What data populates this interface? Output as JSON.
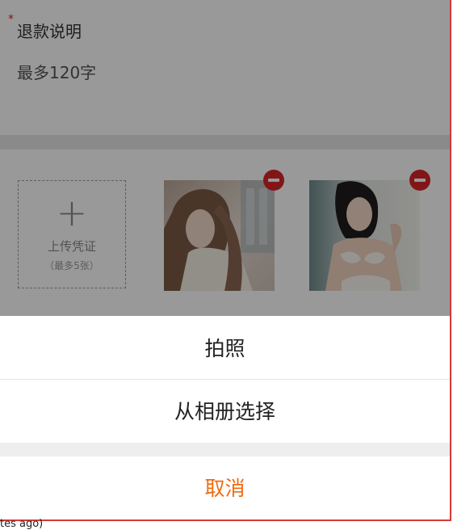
{
  "refund": {
    "required_mark": "*",
    "title": "退款说明",
    "placeholder": "最多120字"
  },
  "upload": {
    "plus_glyph": "+",
    "label": "上传凭证",
    "hint": "（最多5张）"
  },
  "thumbnails": [
    {
      "name": "photo-1"
    },
    {
      "name": "photo-2"
    }
  ],
  "action_sheet": {
    "take_photo": "拍照",
    "choose_album": "从相册选择",
    "cancel": "取消"
  },
  "colors": {
    "cancel_text": "#f06a10",
    "remove_badge": "#d8262a",
    "frame_border": "#d33a36"
  },
  "footer": {
    "fragment": "tes ago)"
  }
}
